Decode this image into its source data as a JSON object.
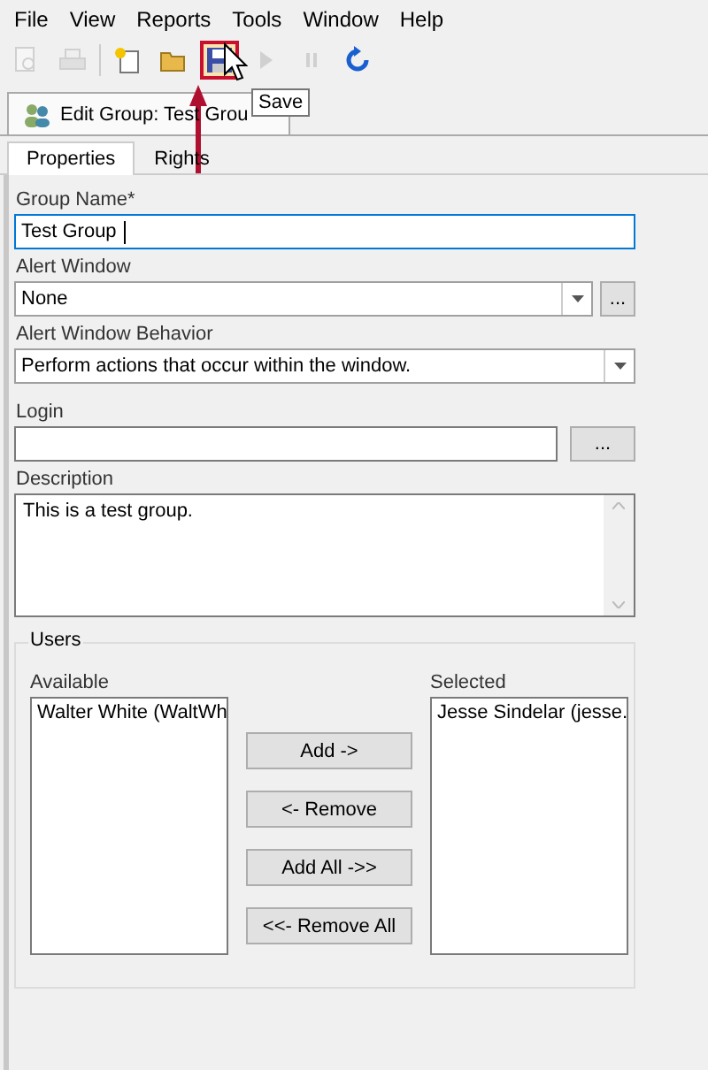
{
  "menu": [
    "File",
    "View",
    "Reports",
    "Tools",
    "Window",
    "Help"
  ],
  "toolbar": [
    {
      "kind": "preview",
      "disabled": true
    },
    {
      "kind": "print",
      "disabled": true
    },
    {
      "kind": "sep"
    },
    {
      "kind": "new",
      "disabled": false
    },
    {
      "kind": "open",
      "disabled": false
    },
    {
      "kind": "save",
      "disabled": false,
      "highlighted": true
    },
    {
      "kind": "play",
      "disabled": true
    },
    {
      "kind": "pause",
      "disabled": true
    },
    {
      "kind": "refresh",
      "disabled": false
    }
  ],
  "tooltip": "Save",
  "document_tab": {
    "title": "Edit Group: Test Grou"
  },
  "tabs": [
    {
      "label": "Properties",
      "selected": true
    },
    {
      "label": "Rights",
      "selected": false
    }
  ],
  "group_name": {
    "label": "Group Name*",
    "value": "Test Group",
    "focused": true
  },
  "alert_window": {
    "label": "Alert Window",
    "value": "None",
    "browse": "..."
  },
  "alert_window_behavior": {
    "label": "Alert Window Behavior",
    "value": "Perform actions that occur within the window."
  },
  "login": {
    "label": "Login",
    "browse": "..."
  },
  "description": {
    "label": "Description",
    "value": "This is a test group."
  },
  "users": {
    "title": "Users",
    "available_label": "Available",
    "available": [
      "Walter White (WaltWh"
    ],
    "selected_label": "Selected",
    "selected": [
      "Jesse Sindelar (jesse."
    ],
    "buttons": [
      "Add ->",
      "<- Remove",
      "Add All ->>",
      "<<- Remove All"
    ]
  }
}
